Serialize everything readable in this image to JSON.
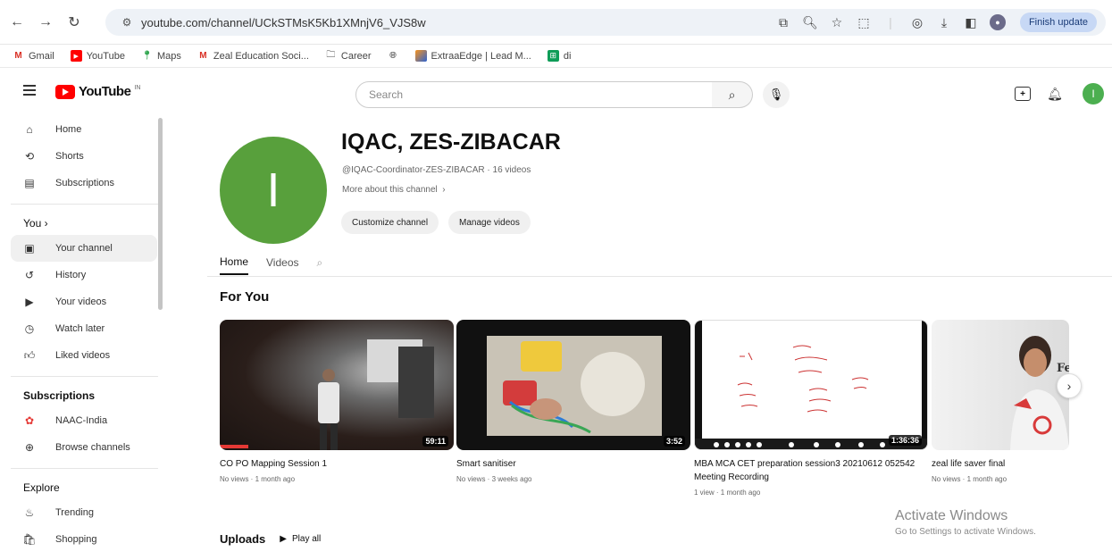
{
  "browser": {
    "url": "youtube.com/channel/UCkSTMsK5Kb1XMnjV6_VJS8w",
    "finish_update": "Finish update",
    "bookmarks": [
      {
        "label": "Gmail",
        "icon": "gmail-icon"
      },
      {
        "label": "YouTube",
        "icon": "youtube-icon"
      },
      {
        "label": "Maps",
        "icon": "maps-icon"
      },
      {
        "label": "Zeal Education Soci...",
        "icon": "gmail-icon"
      },
      {
        "label": "Career",
        "icon": "folder-icon"
      },
      {
        "label": "",
        "icon": "globe-icon"
      },
      {
        "label": "ExtraaEdge | Lead M...",
        "icon": "extraaedge-icon"
      },
      {
        "label": "di",
        "icon": "sheets-icon"
      }
    ]
  },
  "header": {
    "logo_text": "YouTube",
    "logo_sup": "IN",
    "search_placeholder": "Search",
    "avatar_letter": "I"
  },
  "sidebar": {
    "main": [
      {
        "label": "Home",
        "icon": "home-icon"
      },
      {
        "label": "Shorts",
        "icon": "shorts-icon"
      },
      {
        "label": "Subscriptions",
        "icon": "subscriptions-icon"
      }
    ],
    "you_heading": "You",
    "you": [
      {
        "label": "Your channel",
        "icon": "your-channel-icon",
        "active": true
      },
      {
        "label": "History",
        "icon": "history-icon"
      },
      {
        "label": "Your videos",
        "icon": "your-videos-icon"
      },
      {
        "label": "Watch later",
        "icon": "watch-later-icon"
      },
      {
        "label": "Liked videos",
        "icon": "liked-icon"
      }
    ],
    "subs_heading": "Subscriptions",
    "subs": [
      {
        "label": "NAAC-India",
        "icon": "naac-icon"
      },
      {
        "label": "Browse channels",
        "icon": "browse-icon"
      }
    ],
    "explore_heading": "Explore",
    "explore": [
      {
        "label": "Trending",
        "icon": "trending-icon"
      },
      {
        "label": "Shopping",
        "icon": "shopping-icon"
      }
    ]
  },
  "channel": {
    "avatar_letter": "I",
    "name": "IQAC, ZES-ZIBACAR",
    "handle": "@IQAC-Coordinator-ZES-ZIBACAR · 16 videos",
    "more": "More about this channel",
    "customize": "Customize channel",
    "manage": "Manage videos",
    "tabs": [
      "Home",
      "Videos"
    ]
  },
  "for_you": {
    "title": "For You",
    "videos": [
      {
        "title": "CO PO Mapping Session 1",
        "meta": "No views · 1 month ago",
        "duration": "59:11"
      },
      {
        "title": "Smart sanitiser",
        "meta": "No views · 3 weeks ago",
        "duration": "3:52"
      },
      {
        "title": "MBA MCA CET preparation session3 20210612 052542 Meeting Recording",
        "meta": "1 view · 1 month ago",
        "duration": "1:36:36"
      },
      {
        "title": "zeal life saver final",
        "meta": "No views · 1 month ago",
        "duration": ""
      }
    ]
  },
  "uploads": {
    "title": "Uploads",
    "play_all": "Play all"
  },
  "watermark": {
    "title": "Activate Windows",
    "subtitle": "Go to Settings to activate Windows."
  }
}
